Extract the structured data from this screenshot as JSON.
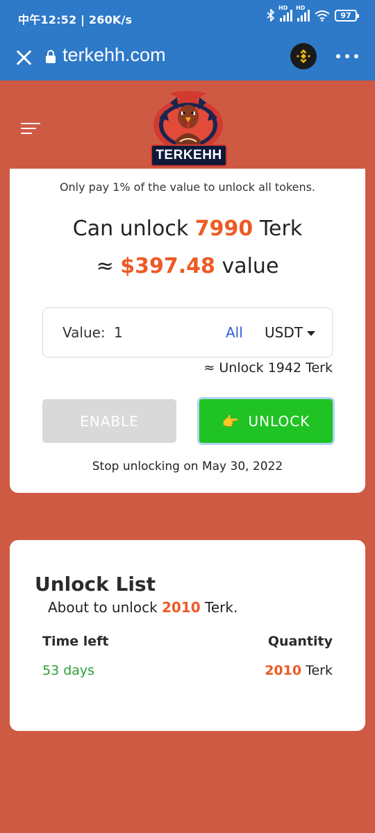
{
  "status_bar": {
    "left_text": "中午12:52 | 260K/s",
    "hd_label": "HD",
    "battery": "97"
  },
  "browser": {
    "url": "terkehh.com"
  },
  "header": {
    "logo_text": "TERKEHH"
  },
  "unlock_card": {
    "description": "Only pay 1% of the value to unlock all tokens.",
    "can_unlock_prefix": "Can unlock ",
    "can_unlock_amount": "7990",
    "can_unlock_suffix": " Terk",
    "value_prefix": "≈ ",
    "value_amount": "$397.48",
    "value_suffix": " value",
    "input_label": "Value:",
    "input_value": "1",
    "all_label": "All",
    "currency": "USDT",
    "approx_unlock": "≈ Unlock 1942 Terk",
    "enable_label": "ENABLE",
    "unlock_label": "UNLOCK",
    "unlock_emoji": "👉",
    "stop_text": "Stop unlocking on May 30, 2022"
  },
  "unlock_list": {
    "title": "Unlock List",
    "sub_prefix": "About to unlock ",
    "sub_amount": "2010",
    "sub_suffix": " Terk.",
    "col_time": "Time left",
    "col_qty": "Quantity",
    "rows": [
      {
        "time": "53 days",
        "qty_amount": "2010",
        "qty_unit": " Terk"
      }
    ]
  },
  "colors": {
    "background": "#cf5a44",
    "bar": "#2e79c8",
    "accent": "#ee5a25",
    "unlock_button": "#1fc324",
    "link": "#2f5bd8",
    "time_green": "#27a033"
  }
}
